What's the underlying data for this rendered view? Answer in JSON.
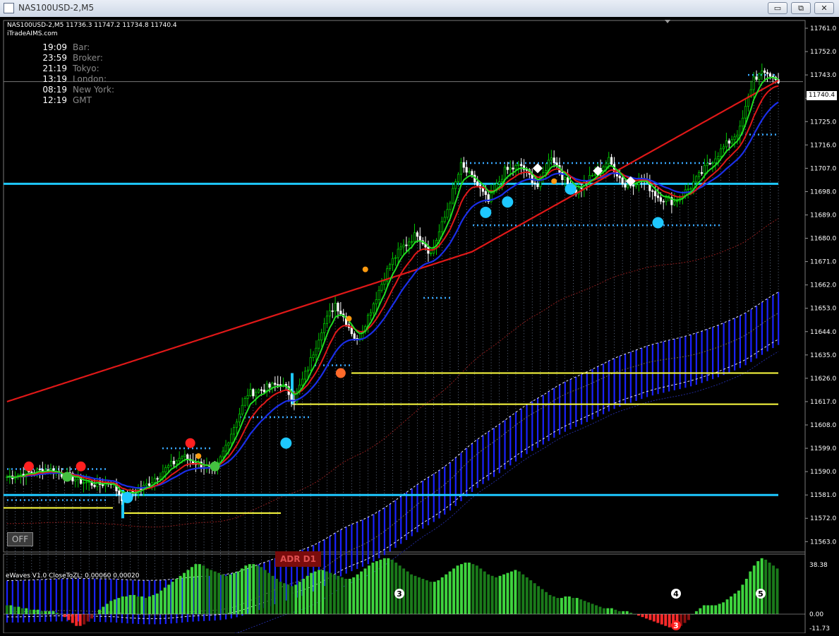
{
  "window": {
    "title": "NAS100USD-2,M5",
    "buttons": {
      "minimize": "▭",
      "restore": "⧉",
      "close": "✕"
    }
  },
  "chart_header": {
    "line1": "NAS100USD-2,M5  11736.3 11747.2 11734.8 11740.4",
    "line2": "iTradeAIMS.com"
  },
  "clocks": [
    {
      "time": "19:09",
      "label": "Bar:"
    },
    {
      "time": "23:59",
      "label": "Broker:"
    },
    {
      "time": "21:19",
      "label": "Tokyo:"
    },
    {
      "time": "13:19",
      "label": "London:"
    },
    {
      "time": "08:19",
      "label": "New York:"
    },
    {
      "time": "12:19",
      "label": "GMT"
    }
  ],
  "off_button": "OFF",
  "adr_label": "ADR D1",
  "current_price": "11740.4",
  "oscillator": {
    "label": "eWaves V1.0 CloseToZL: 0.00060 0.00020",
    "axis": [
      "38.38",
      "0.00",
      "-11.73"
    ],
    "wave_labels": [
      "3",
      "4",
      "3",
      "5"
    ]
  },
  "colors": {
    "background": "#000000",
    "bull": "#00c800",
    "bear": "#ffffff",
    "ma_green": "#22dd22",
    "ma_red": "#e01818",
    "ma_blue": "#1a2ee8",
    "level_cyan": "#1ec8ff",
    "level_yellow": "#ffff40",
    "hist_pos": "#33cc33",
    "hist_neg": "#ee1111"
  },
  "chart_data": {
    "type": "candlestick",
    "symbol": "NAS100USD-2",
    "timeframe": "M5",
    "ylim": [
      11559,
      11764
    ],
    "yticks": [
      "11761.0",
      "11752.0",
      "11743.0",
      "11734.0",
      "11725.0",
      "11716.0",
      "11707.0",
      "11698.0",
      "11689.0",
      "11680.0",
      "11671.0",
      "11662.0",
      "11653.0",
      "11644.0",
      "11635.0",
      "11626.0",
      "11617.0",
      "11608.0",
      "11599.0",
      "11590.0",
      "11581.0",
      "11572.0",
      "11563.0"
    ],
    "anchors": [
      [
        0,
        11588
      ],
      [
        15,
        11591
      ],
      [
        28,
        11586
      ],
      [
        33,
        11585
      ],
      [
        38,
        11586
      ],
      [
        42,
        11580
      ],
      [
        50,
        11584
      ],
      [
        58,
        11591
      ],
      [
        64,
        11596
      ],
      [
        70,
        11593
      ],
      [
        76,
        11590
      ],
      [
        82,
        11605
      ],
      [
        88,
        11620
      ],
      [
        94,
        11622
      ],
      [
        100,
        11624
      ],
      [
        105,
        11618
      ],
      [
        110,
        11630
      ],
      [
        115,
        11645
      ],
      [
        120,
        11655
      ],
      [
        124,
        11648
      ],
      [
        128,
        11640
      ],
      [
        132,
        11650
      ],
      [
        136,
        11660
      ],
      [
        140,
        11670
      ],
      [
        144,
        11676
      ],
      [
        150,
        11682
      ],
      [
        155,
        11674
      ],
      [
        160,
        11688
      ],
      [
        166,
        11708
      ],
      [
        171,
        11702
      ],
      [
        176,
        11694
      ],
      [
        182,
        11706
      ],
      [
        188,
        11708
      ],
      [
        194,
        11700
      ],
      [
        199,
        11712
      ],
      [
        204,
        11702
      ],
      [
        208,
        11698
      ],
      [
        214,
        11704
      ],
      [
        220,
        11710
      ],
      [
        226,
        11700
      ],
      [
        232,
        11703
      ],
      [
        238,
        11696
      ],
      [
        244,
        11694
      ],
      [
        250,
        11700
      ],
      [
        256,
        11708
      ],
      [
        262,
        11715
      ],
      [
        268,
        11722
      ],
      [
        273,
        11742
      ],
      [
        278,
        11744
      ],
      [
        282,
        11740
      ]
    ],
    "osc_values": [
      6,
      6,
      5,
      5,
      4,
      4,
      3,
      3,
      3,
      2,
      2,
      2,
      2,
      1,
      0,
      -2,
      -4,
      -6,
      -8,
      -8,
      -7,
      -5,
      -3,
      0,
      3,
      5,
      7,
      9,
      10,
      11,
      12,
      12,
      13,
      13,
      12,
      12,
      11,
      12,
      13,
      14,
      16,
      18,
      20,
      22,
      24,
      26,
      28,
      30,
      32,
      34,
      34,
      33,
      31,
      30,
      29,
      28,
      27,
      26,
      27,
      28,
      29,
      31,
      33,
      34,
      34,
      33,
      32,
      30,
      28,
      26,
      24,
      22,
      21,
      20,
      19,
      20,
      22,
      24,
      26,
      28,
      29,
      30,
      30,
      29,
      28,
      27,
      26,
      25,
      24,
      24,
      25,
      27,
      29,
      31,
      33,
      35,
      36,
      37,
      38,
      38,
      37,
      35,
      33,
      31,
      29,
      27,
      26,
      25,
      24,
      23,
      22,
      22,
      23,
      25,
      27,
      29,
      31,
      33,
      34,
      35,
      35,
      34,
      33,
      31,
      29,
      27,
      26,
      25,
      26,
      27,
      28,
      29,
      30,
      29,
      27,
      25,
      23,
      21,
      19,
      17,
      15,
      13,
      12,
      11,
      11,
      12,
      12,
      11,
      11,
      10,
      9,
      8,
      7,
      6,
      5,
      4,
      4,
      4,
      3,
      2,
      2,
      2,
      1,
      0,
      -1,
      -2,
      -3,
      -4,
      -5,
      -6,
      -7,
      -8,
      -9,
      -9,
      -9,
      -8,
      -6,
      -4,
      0,
      2,
      4,
      6,
      6,
      6,
      6,
      7,
      8,
      10,
      12,
      14,
      16,
      20,
      24,
      29,
      33,
      36,
      38,
      37,
      35,
      33,
      31
    ],
    "horizontal_levels": [
      11701,
      11581
    ],
    "yellow_levels": [
      11628,
      11616,
      11574
    ]
  }
}
